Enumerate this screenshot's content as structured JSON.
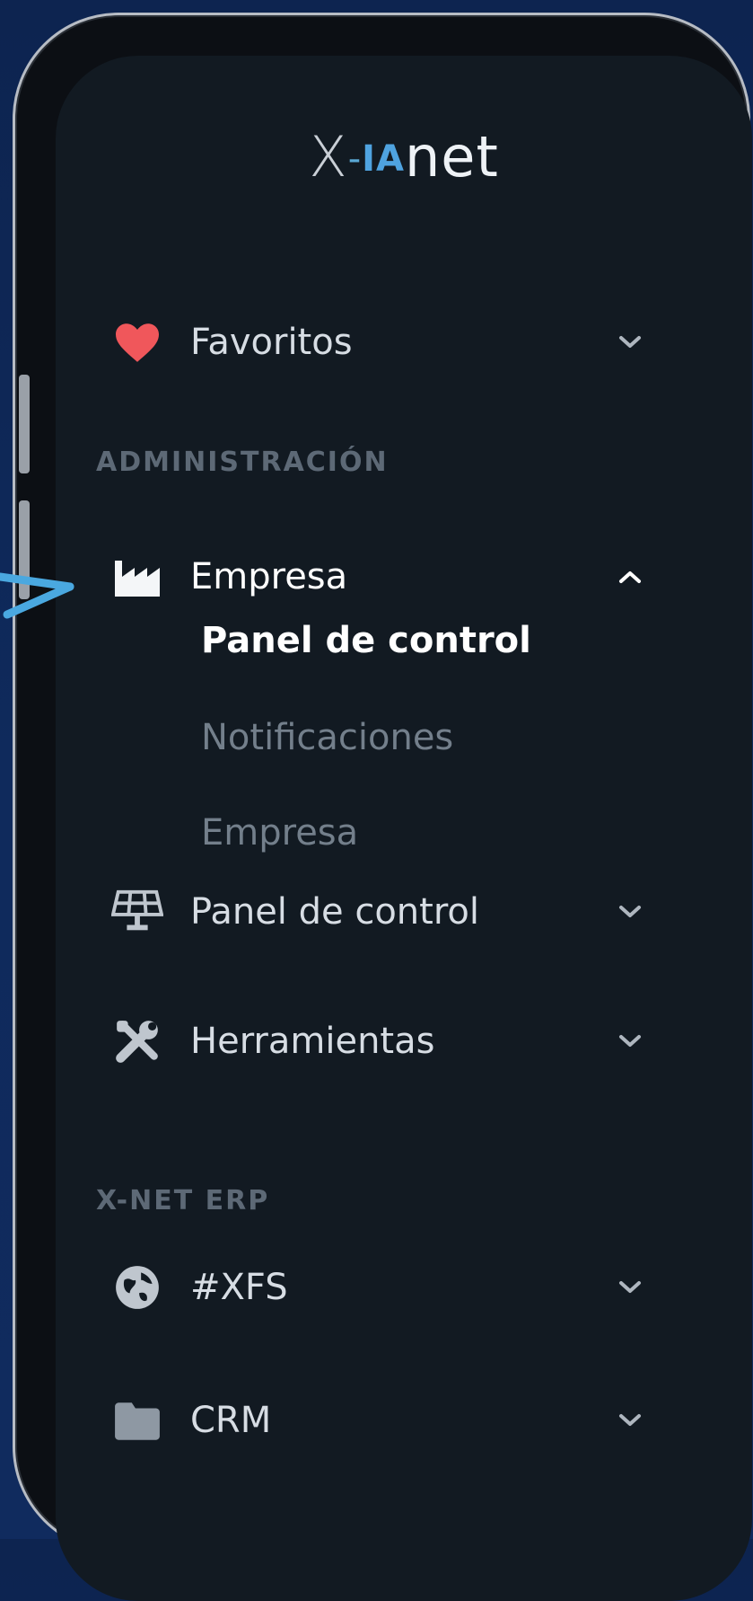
{
  "logo": {
    "x": "X",
    "dash": "-",
    "ia": "IA",
    "net": "net"
  },
  "menu": {
    "favoritos": {
      "label": "Favoritos",
      "icon": "heart-icon",
      "expanded": false
    },
    "section_admin": "ADMINISTRACIÓN",
    "empresa": {
      "label": "Empresa",
      "icon": "factory-icon",
      "expanded": true,
      "children": [
        {
          "label": "Panel de control",
          "active": true
        },
        {
          "label": "Notificaciones",
          "active": false
        },
        {
          "label": "Empresa",
          "active": false
        }
      ]
    },
    "panel": {
      "label": "Panel de control",
      "icon": "solar-panel-icon",
      "expanded": false
    },
    "herramientas": {
      "label": "Herramientas",
      "icon": "tools-icon",
      "expanded": false
    },
    "section_erp": "X-NET ERP",
    "xfs": {
      "label": "#XFS",
      "icon": "globe-icon",
      "expanded": false
    },
    "crm": {
      "label": "CRM",
      "icon": "folder-icon",
      "expanded": false
    }
  },
  "colors": {
    "accent": "#4fa3e0",
    "heart": "#f0575b",
    "background": "#121a22",
    "arrow": "#4aa8e0"
  }
}
